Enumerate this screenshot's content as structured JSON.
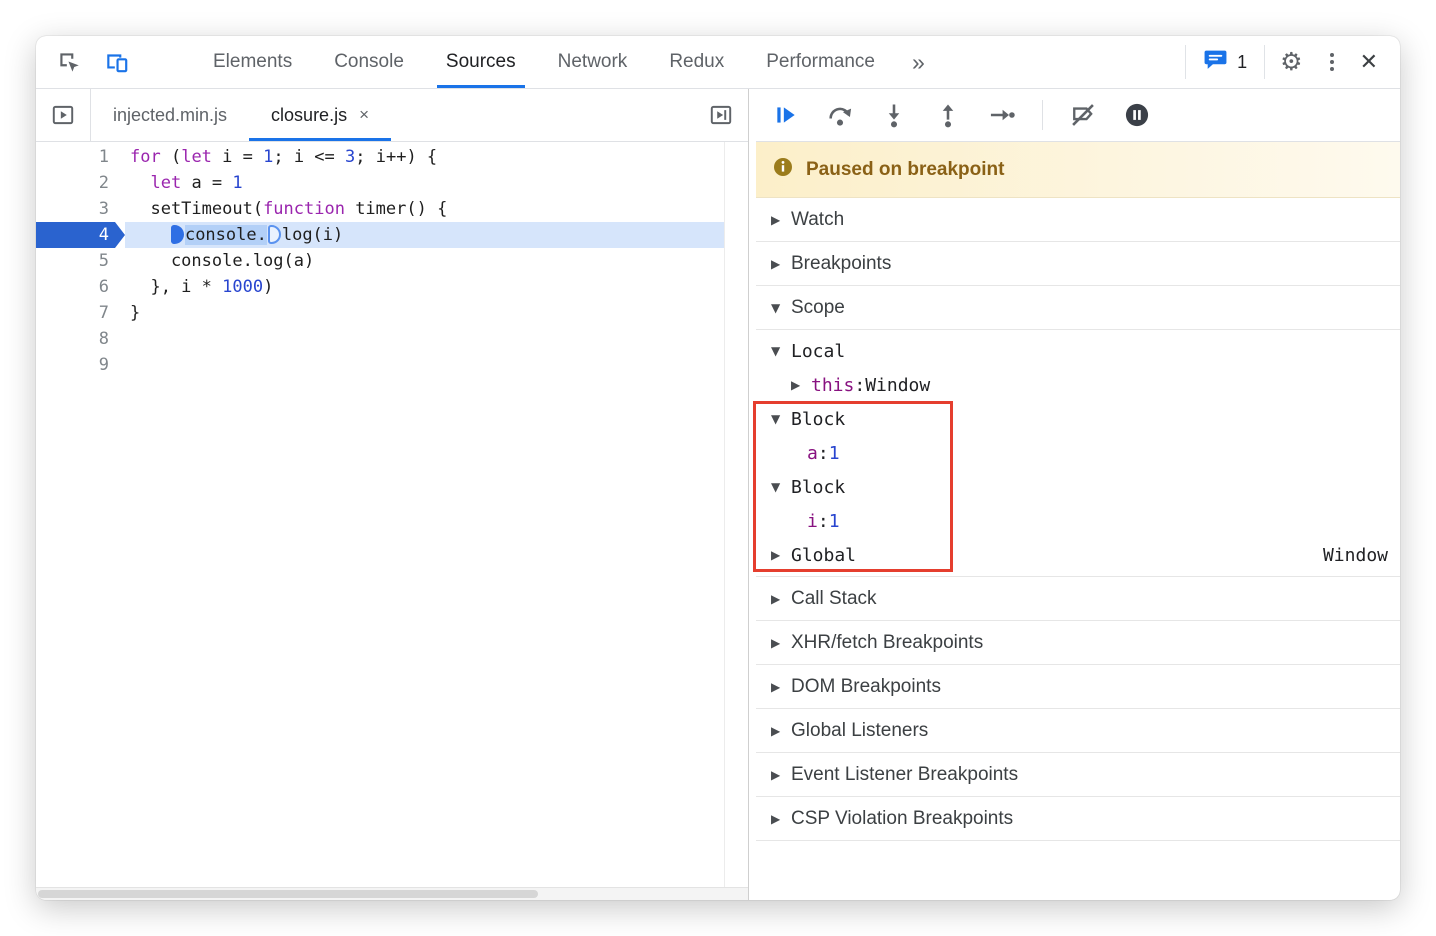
{
  "top_toolbar": {
    "tabs": [
      {
        "label": "Elements",
        "active": false
      },
      {
        "label": "Console",
        "active": false
      },
      {
        "label": "Sources",
        "active": true
      },
      {
        "label": "Network",
        "active": false
      },
      {
        "label": "Redux",
        "active": false
      },
      {
        "label": "Performance",
        "active": false
      }
    ],
    "more_tabs_glyph": "»",
    "console_drawer_badge": "1",
    "settings_glyph": "⚙",
    "close_glyph": "✕"
  },
  "file_tab_bar": {
    "tabs": [
      {
        "label": "injected.min.js",
        "active": false
      },
      {
        "label": "closure.js",
        "active": true,
        "close_glyph": "×"
      }
    ]
  },
  "editor": {
    "lines": [
      {
        "num": "1",
        "segs": [
          [
            "kw",
            "for"
          ],
          [
            "p",
            " ("
          ],
          [
            "kw",
            "let"
          ],
          [
            "p",
            " i = "
          ],
          [
            "num",
            "1"
          ],
          [
            "p",
            "; i <= "
          ],
          [
            "num",
            "3"
          ],
          [
            "p",
            "; i++) {"
          ]
        ]
      },
      {
        "num": "2",
        "segs": [
          [
            "p",
            "  "
          ],
          [
            "kw",
            "let"
          ],
          [
            "p",
            " a = "
          ],
          [
            "num",
            "1"
          ]
        ]
      },
      {
        "num": "3",
        "segs": [
          [
            "p",
            "  setTimeout("
          ],
          [
            "kw",
            "function"
          ],
          [
            "p",
            " timer() {"
          ]
        ]
      },
      {
        "num": "4",
        "current": true,
        "segs": [
          [
            "p",
            "    "
          ],
          [
            "chip1",
            ""
          ],
          [
            "hl",
            "console."
          ],
          [
            "chip2",
            ""
          ],
          [
            "p",
            "log(i)"
          ]
        ]
      },
      {
        "num": "5",
        "segs": [
          [
            "p",
            "    console.log(a)"
          ]
        ]
      },
      {
        "num": "6",
        "segs": [
          [
            "p",
            "  }, i * "
          ],
          [
            "num",
            "1000"
          ],
          [
            "p",
            ")"
          ]
        ]
      },
      {
        "num": "7",
        "segs": [
          [
            "p",
            "}"
          ]
        ]
      },
      {
        "num": "8",
        "segs": []
      },
      {
        "num": "9",
        "segs": []
      }
    ]
  },
  "debugger_toolbar": {
    "icons": [
      {
        "name": "resume-script-execution"
      },
      {
        "name": "step-over"
      },
      {
        "name": "step-into"
      },
      {
        "name": "step-out"
      },
      {
        "name": "step"
      },
      {
        "name": "separator"
      },
      {
        "name": "deactivate-breakpoints"
      },
      {
        "name": "pause-on-exceptions"
      }
    ]
  },
  "paused_banner": {
    "text": "Paused on breakpoint"
  },
  "sidebar": {
    "sections_before_scope": [
      {
        "label": "Watch"
      },
      {
        "label": "Breakpoints"
      }
    ],
    "scope": {
      "label": "Scope",
      "items": [
        {
          "type": "expanded",
          "label": "Local",
          "indent": 0
        },
        {
          "type": "collapsed-kv",
          "name": "this",
          "value": "Window",
          "value_kind": "obj",
          "indent": 1
        },
        {
          "type": "expanded",
          "label": "Block",
          "indent": 0
        },
        {
          "type": "kv",
          "name": "a",
          "value": "1",
          "value_kind": "num",
          "indent": 1
        },
        {
          "type": "expanded",
          "label": "Block",
          "indent": 0
        },
        {
          "type": "kv",
          "name": "i",
          "value": "1",
          "value_kind": "num",
          "indent": 1
        },
        {
          "type": "collapsed",
          "label": "Global",
          "right_value": "Window",
          "indent": 0
        }
      ]
    },
    "sections_after_scope": [
      {
        "label": "Call Stack"
      },
      {
        "label": "XHR/fetch Breakpoints"
      },
      {
        "label": "DOM Breakpoints"
      },
      {
        "label": "Global Listeners"
      },
      {
        "label": "Event Listener Breakpoints"
      },
      {
        "label": "CSP Violation Breakpoints"
      }
    ]
  },
  "colors": {
    "accent_blue": "#1a73e8",
    "exec_line_bg": "#d6e5fb",
    "exec_gutter_bg": "#2a63cf",
    "annotation_red": "#e53e2e",
    "banner_bg": "#fcefc9",
    "banner_text": "#8a6116",
    "keyword": "#9a25ae",
    "number": "#2845cf",
    "scope_var_name": "#881280"
  }
}
